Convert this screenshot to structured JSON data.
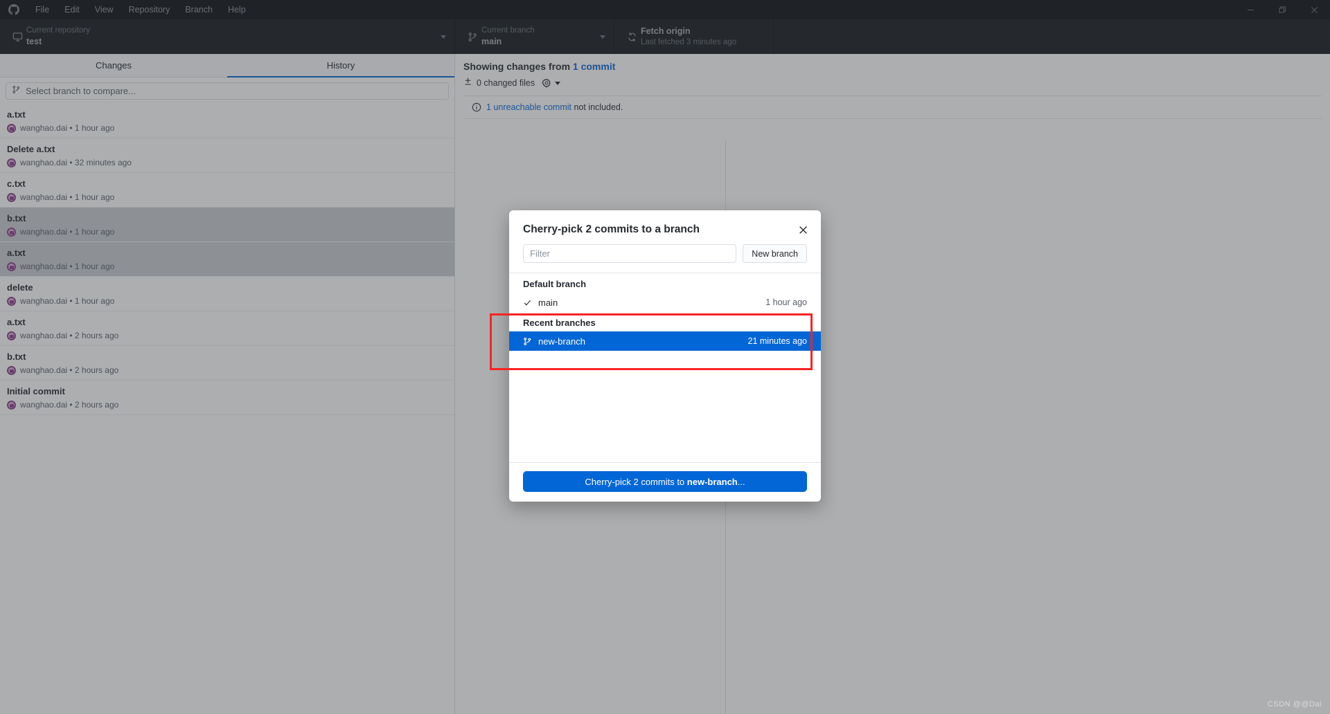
{
  "titlebar": {
    "logo_icon": "github-mark-icon",
    "menus": [
      {
        "label": "File"
      },
      {
        "label": "Edit"
      },
      {
        "label": "View"
      },
      {
        "label": "Repository"
      },
      {
        "label": "Branch"
      },
      {
        "label": "Help"
      }
    ],
    "window_controls": [
      {
        "name": "minimize-button",
        "icon": "minimize-icon"
      },
      {
        "name": "maximize-button",
        "icon": "restore-icon"
      },
      {
        "name": "close-button",
        "icon": "close-icon"
      }
    ]
  },
  "toolbar": {
    "repository": {
      "icon": "repository-icon",
      "label": "Current repository",
      "value": "test"
    },
    "branch": {
      "icon": "branch-icon",
      "label": "Current branch",
      "value": "main"
    },
    "fetch": {
      "icon": "sync-icon",
      "title": "Fetch origin",
      "subtitle": "Last fetched 3 minutes ago"
    }
  },
  "sidebar": {
    "tabs": [
      {
        "label": "Changes",
        "active": false
      },
      {
        "label": "History",
        "active": true
      }
    ],
    "compare": {
      "icon": "branch-icon",
      "placeholder": "Select branch to compare..."
    },
    "commits": [
      {
        "title": "a.txt",
        "author": "wanghao.dai",
        "time": "1 hour ago",
        "selected": false
      },
      {
        "title": "Delete a.txt",
        "author": "wanghao.dai",
        "time": "32 minutes ago",
        "selected": false
      },
      {
        "title": "c.txt",
        "author": "wanghao.dai",
        "time": "1 hour ago",
        "selected": false
      },
      {
        "title": "b.txt",
        "author": "wanghao.dai",
        "time": "1 hour ago",
        "selected": true
      },
      {
        "title": "a.txt",
        "author": "wanghao.dai",
        "time": "1 hour ago",
        "selected": true
      },
      {
        "title": "delete",
        "author": "wanghao.dai",
        "time": "1 hour ago",
        "selected": false
      },
      {
        "title": "a.txt",
        "author": "wanghao.dai",
        "time": "2 hours ago",
        "selected": false
      },
      {
        "title": "b.txt",
        "author": "wanghao.dai",
        "time": "2 hours ago",
        "selected": false
      },
      {
        "title": "Initial commit",
        "author": "wanghao.dai",
        "time": "2 hours ago",
        "selected": false
      }
    ],
    "separator": "•"
  },
  "main": {
    "heading_prefix": "Showing changes from ",
    "heading_link": "1 commit",
    "changed_files": "0 changed files",
    "diff_options_icon": "gear-icon",
    "expand_icon": "expand-diff-icon",
    "info_icon": "info-icon",
    "info_link": "1 unreachable commit",
    "info_suffix": " not included."
  },
  "modal": {
    "title": "Cherry-pick 2 commits to a branch",
    "close_icon": "close-icon",
    "filter_placeholder": "Filter",
    "filter_value": "",
    "new_branch_label": "New branch",
    "groups": [
      {
        "heading": "Default branch",
        "branches": [
          {
            "name": "main",
            "time": "1 hour ago",
            "icon": "check-icon",
            "selected": false
          }
        ]
      },
      {
        "heading": "Recent branches",
        "branches": [
          {
            "name": "new-branch",
            "time": "21 minutes ago",
            "icon": "branch-icon",
            "selected": true
          }
        ]
      }
    ],
    "confirm_prefix": "Cherry-pick 2 commits to ",
    "confirm_branch": "new-branch",
    "confirm_suffix": "..."
  },
  "annotation": {
    "highlight_color": "#fb2222"
  },
  "watermark": {
    "text": "CSDN @@Dai"
  },
  "colors": {
    "accent": "#0366d6",
    "titlebar_bg": "#14181d",
    "toolbar_bg": "#24292e",
    "selected_branch_bg": "#0366d6",
    "highlight_red": "#fb2222"
  }
}
